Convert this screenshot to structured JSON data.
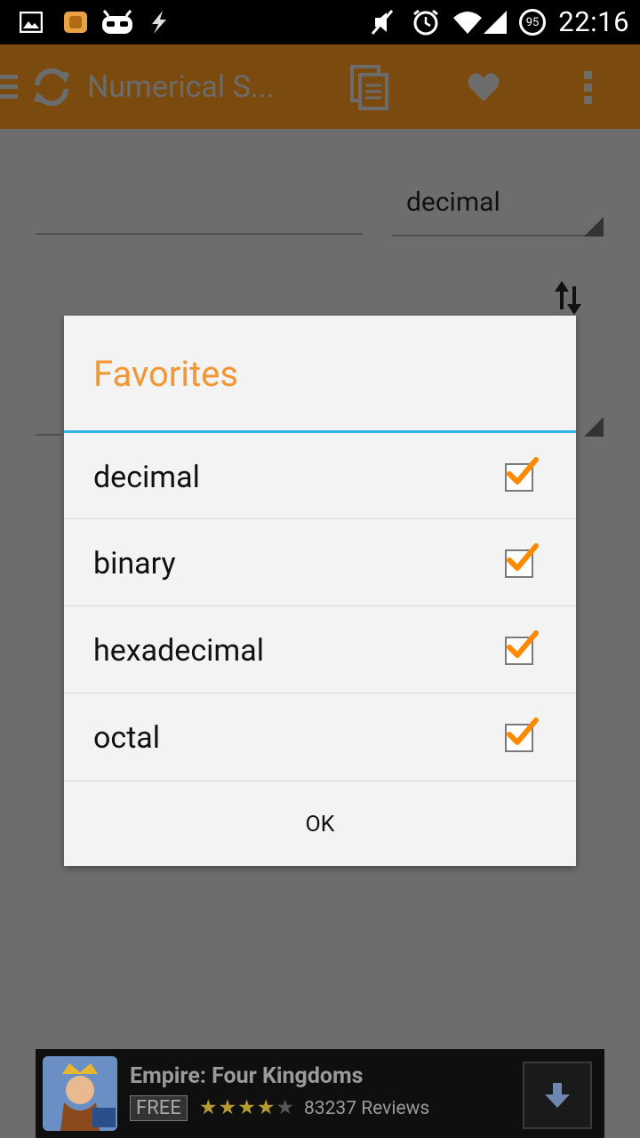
{
  "status_bar": {
    "battery": "95",
    "time": "22:16"
  },
  "action_bar": {
    "title": "Numerical S..."
  },
  "background": {
    "from_unit": "decimal"
  },
  "dialog": {
    "title": "Favorites",
    "options": [
      {
        "label": "decimal",
        "checked": true
      },
      {
        "label": "binary",
        "checked": true
      },
      {
        "label": "hexadecimal",
        "checked": true
      },
      {
        "label": "octal",
        "checked": true
      }
    ],
    "ok_label": "OK"
  },
  "ad": {
    "title": "Empire: Four Kingdoms",
    "badge": "FREE",
    "stars": "★★★★",
    "star_empty": "★",
    "reviews": "83237 Reviews"
  },
  "colors": {
    "accent": "#f29734",
    "divider": "#33b5e5",
    "action_bar": "#e08c1e"
  }
}
